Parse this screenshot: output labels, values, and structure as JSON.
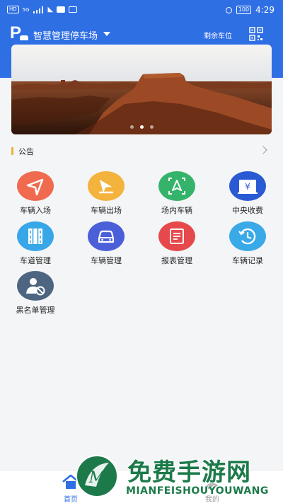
{
  "status_bar": {
    "left_chip": "HD",
    "net": "5G",
    "time": "4:29",
    "battery": "100"
  },
  "header": {
    "lot_name": "智慧管理停车场",
    "remaining_label": "剩余车位"
  },
  "banner": {
    "slide_count": 3,
    "active_slide": 2
  },
  "notice": {
    "label": "公告"
  },
  "menu": [
    {
      "label": "车辆入场",
      "icon": "car-entry-icon",
      "color": "#ef6a4e"
    },
    {
      "label": "车辆出场",
      "icon": "car-exit-icon",
      "color": "#f3b33d"
    },
    {
      "label": "场内车辆",
      "icon": "in-lot-vehicles-icon",
      "color": "#35b36b"
    },
    {
      "label": "中央收费",
      "icon": "central-payment-icon",
      "color": "#2a5ad3"
    },
    {
      "label": "车道管理",
      "icon": "lane-management-icon",
      "color": "#37a7e8"
    },
    {
      "label": "车辆管理",
      "icon": "vehicle-management-icon",
      "color": "#4a5fd8"
    },
    {
      "label": "报表管理",
      "icon": "report-management-icon",
      "color": "#e6494b"
    },
    {
      "label": "车辆记录",
      "icon": "vehicle-record-icon",
      "color": "#39a9e8"
    },
    {
      "label": "黑名单管理",
      "icon": "blacklist-icon",
      "color": "#4d6580"
    }
  ],
  "bottom_nav": {
    "home_label": "首页",
    "mine_label": "我的"
  },
  "watermark": {
    "title": "免费手游网",
    "subtitle": "MIANFEISHOUYOUWANG"
  }
}
